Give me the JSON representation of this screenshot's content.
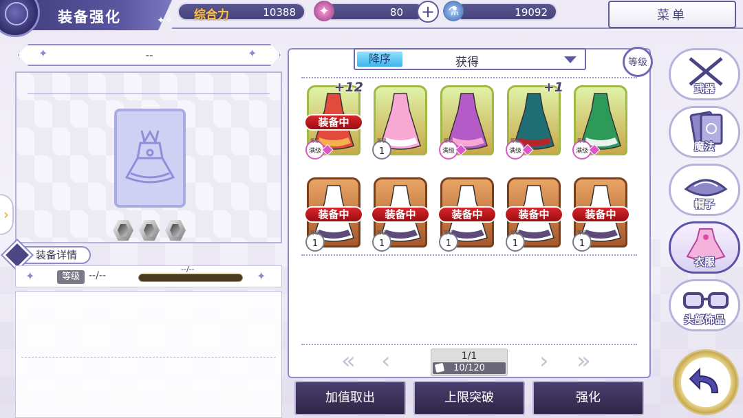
{
  "header": {
    "title": "装备强化",
    "power_label": "综合力",
    "power_value": "10388",
    "stamina_value": "80",
    "plus_symbol": "+",
    "mana_value": "19092",
    "menu_label": "菜单"
  },
  "left_panel": {
    "equip_name": "--",
    "detail_tab_label": "装备详情",
    "level_badge": "等级",
    "level_value": "--/--",
    "exp_text": "--/--",
    "gems": [
      "hex-gem",
      "hex-gem",
      "hex-gem"
    ]
  },
  "inventory": {
    "sort_order": "降序",
    "sort_field": "获得",
    "level_filter": "等级",
    "equipped_label": "装备中",
    "max_level_label": "满级",
    "items": [
      {
        "frame": "gold",
        "equipped": true,
        "plus": "+12",
        "level": "满级",
        "color": "#e24a3c",
        "accent": "#f6b04e"
      },
      {
        "frame": "gold",
        "equipped": false,
        "plus": "",
        "level": "1",
        "color": "#f7a9d4",
        "accent": "#ffffff"
      },
      {
        "frame": "gold",
        "equipped": false,
        "plus": "",
        "level": "满级",
        "color": "#b55bc7",
        "accent": "#f7a9d4"
      },
      {
        "frame": "gold",
        "equipped": false,
        "plus": "+1",
        "level": "满级",
        "color": "#1f6e74",
        "accent": "#b7252b"
      },
      {
        "frame": "gold",
        "equipped": false,
        "plus": "",
        "level": "满级",
        "color": "#2e9a5a",
        "accent": "#e9f4ec"
      },
      {
        "frame": "bronze",
        "equipped": true,
        "plus": "",
        "level": "1",
        "color": "#ffffff",
        "accent": "#5d4b7a"
      },
      {
        "frame": "bronze",
        "equipped": true,
        "plus": "",
        "level": "1",
        "color": "#ffffff",
        "accent": "#5d4b7a"
      },
      {
        "frame": "bronze",
        "equipped": true,
        "plus": "",
        "level": "1",
        "color": "#ffffff",
        "accent": "#5d4b7a"
      },
      {
        "frame": "bronze",
        "equipped": true,
        "plus": "",
        "level": "1",
        "color": "#ffffff",
        "accent": "#5d4b7a"
      },
      {
        "frame": "bronze",
        "equipped": true,
        "plus": "",
        "level": "1",
        "color": "#ffffff",
        "accent": "#5d4b7a"
      }
    ],
    "page": "1/1",
    "count": "10/120"
  },
  "actions": {
    "sell": "加值取出",
    "limit_break": "上限突破",
    "enhance": "强化"
  },
  "categories": [
    {
      "label": "武器",
      "icon": "crossed-swords-icon",
      "active": false
    },
    {
      "label": "魔法",
      "icon": "magic-card-icon",
      "active": false
    },
    {
      "label": "帽子",
      "icon": "hat-icon",
      "active": false
    },
    {
      "label": "衣服",
      "icon": "dress-icon",
      "active": true
    },
    {
      "label": "头部饰品",
      "icon": "glasses-icon",
      "active": false
    }
  ],
  "colors": {
    "accent": "#5a56a0",
    "equipped_red": "#c41a1f",
    "sort_blue": "#3fb4e8"
  }
}
